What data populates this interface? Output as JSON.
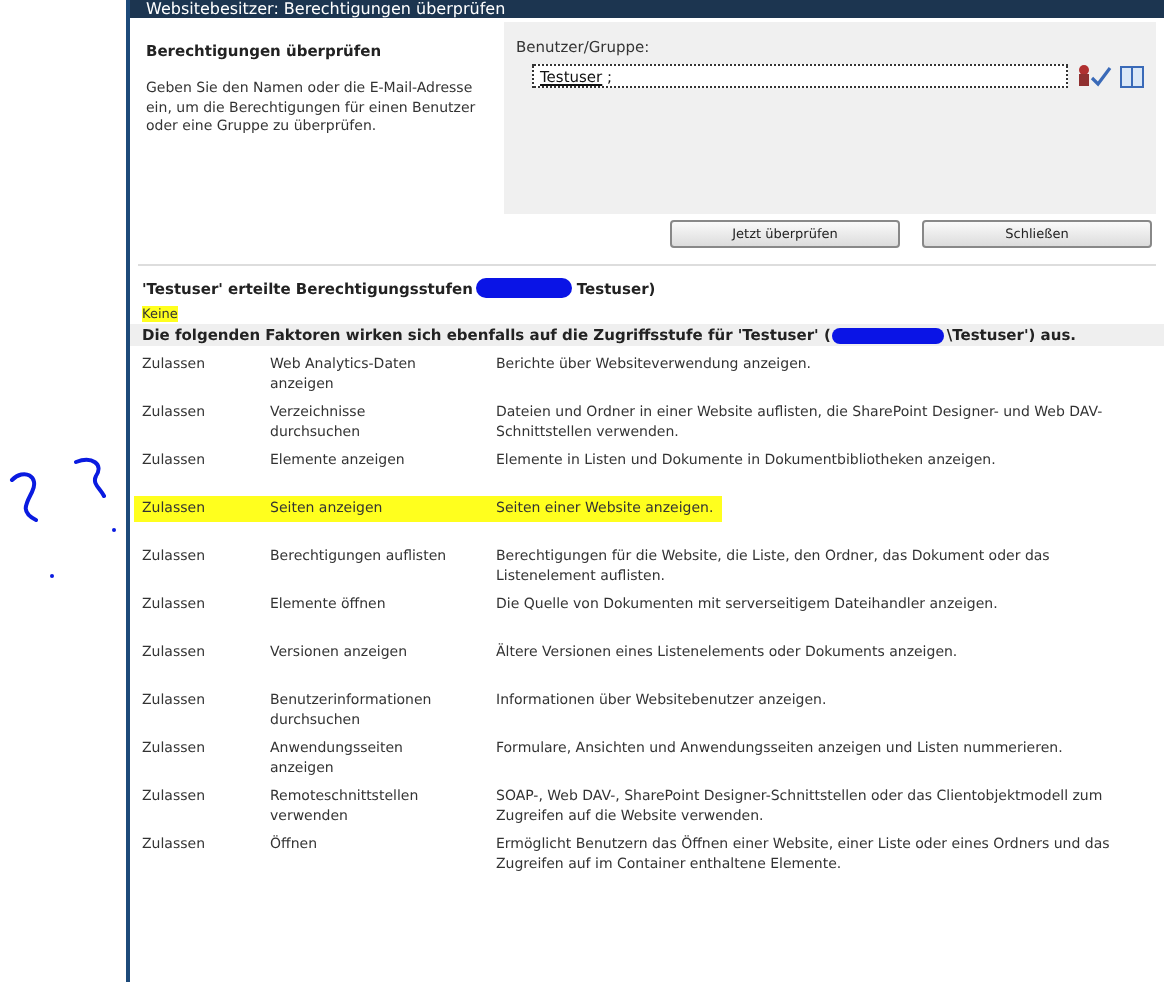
{
  "window": {
    "title": "Websitebesitzer: Berechtigungen überprüfen"
  },
  "section": {
    "title": "Berechtigungen überprüfen",
    "description": "Geben Sie den Namen oder die E-Mail-Adresse ein, um die Berechtigungen für einen Benutzer oder eine Gruppe zu überprüfen."
  },
  "user_field": {
    "label": "Benutzer/Gruppe:",
    "value": "Testuser",
    "separator": ";"
  },
  "buttons": [
    "Jetzt überprüfen",
    "Schließen"
  ],
  "granted": {
    "before": "'Testuser' erteilte Berechtigungsstufen",
    "after": "Testuser)"
  },
  "granted_value": {
    "text": "Keine",
    "highlighted": true
  },
  "factors": {
    "before": "Die folgenden Faktoren wirken sich ebenfalls auf die Zugriffsstufe für 'Testuser' (",
    "after": "\\Testuser') aus."
  },
  "rows": [
    {
      "permission": "Zulassen",
      "name": "Web Analytics-Daten anzeigen",
      "description": "Berichte über Websiteverwendung anzeigen.",
      "highlighted": false
    },
    {
      "permission": "Zulassen",
      "name": "Verzeichnisse durchsuchen",
      "description": "Dateien und Ordner in einer Website auflisten, die SharePoint Designer- und Web DAV-Schnittstellen verwenden.",
      "highlighted": false
    },
    {
      "permission": "Zulassen",
      "name": "Elemente anzeigen",
      "description": "Elemente in Listen und Dokumente in Dokumentbibliotheken anzeigen.",
      "highlighted": false
    },
    {
      "permission": "Zulassen",
      "name": "Seiten anzeigen",
      "description": "Seiten einer Website anzeigen.",
      "highlighted": true
    },
    {
      "permission": "Zulassen",
      "name": "Berechtigungen auflisten",
      "description": "Berechtigungen für die Website, die Liste, den Ordner, das Dokument oder das Listenelement auflisten.",
      "highlighted": false
    },
    {
      "permission": "Zulassen",
      "name": "Elemente öffnen",
      "description": "Die Quelle von Dokumenten mit serverseitigem Dateihandler anzeigen.",
      "highlighted": false
    },
    {
      "permission": "Zulassen",
      "name": "Versionen anzeigen",
      "description": "Ältere Versionen eines Listenelements oder Dokuments anzeigen.",
      "highlighted": false
    },
    {
      "permission": "Zulassen",
      "name": "Benutzerinformationen durchsuchen",
      "description": "Informationen über Websitebenutzer anzeigen.",
      "highlighted": false
    },
    {
      "permission": "Zulassen",
      "name": "Anwendungsseiten anzeigen",
      "description": "Formulare, Ansichten und Anwendungsseiten anzeigen und Listen nummerieren.",
      "highlighted": false
    },
    {
      "permission": "Zulassen",
      "name": "Remoteschnittstellen verwenden",
      "description": "SOAP-, Web DAV-, SharePoint Designer-Schnittstellen oder das Clientobjektmodell zum Zugreifen auf die Website verwenden.",
      "highlighted": false
    },
    {
      "permission": "Zulassen",
      "name": "Öffnen",
      "description": "Ermöglicht Benutzern das Öffnen einer Website, einer Liste oder eines Ordners und das Zugreifen auf im Container enthaltene Elemente.",
      "highlighted": false
    }
  ]
}
